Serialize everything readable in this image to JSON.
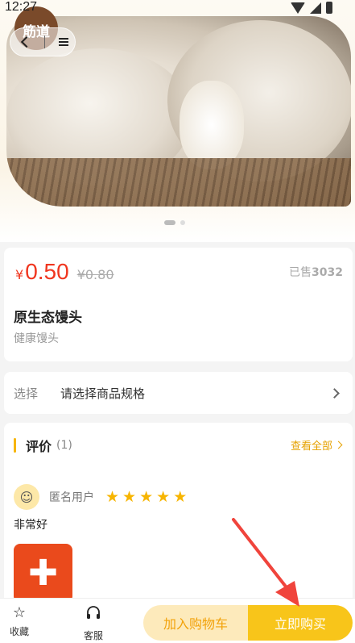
{
  "status_bar": {
    "time": "12:27"
  },
  "hero": {
    "watermark_text": "筋道",
    "carousel": {
      "count": 2,
      "active": 1
    }
  },
  "product": {
    "currency": "¥",
    "price": "0.50",
    "original_price": "¥0.80",
    "sold_label": "已售",
    "sold_count": "3032",
    "name": "原生态馒头",
    "subtitle": "健康馒头"
  },
  "spec": {
    "label": "选择",
    "value": "请选择商品规格"
  },
  "reviews": {
    "title": "评价",
    "count": "(1)",
    "view_all": "查看全部",
    "items": [
      {
        "user": "匿名用户",
        "rating": 5,
        "text": "非常好"
      }
    ]
  },
  "bottom_bar": {
    "favorite": "收藏",
    "service": "客服",
    "add_to_cart": "加入购物车",
    "buy_now": "立即购买"
  },
  "colors": {
    "price": "#f0361f",
    "accent": "#f7b500",
    "buy_button": "#f8c51a",
    "cart_button": "#fdeabb",
    "annotation_arrow": "#f0443c"
  }
}
